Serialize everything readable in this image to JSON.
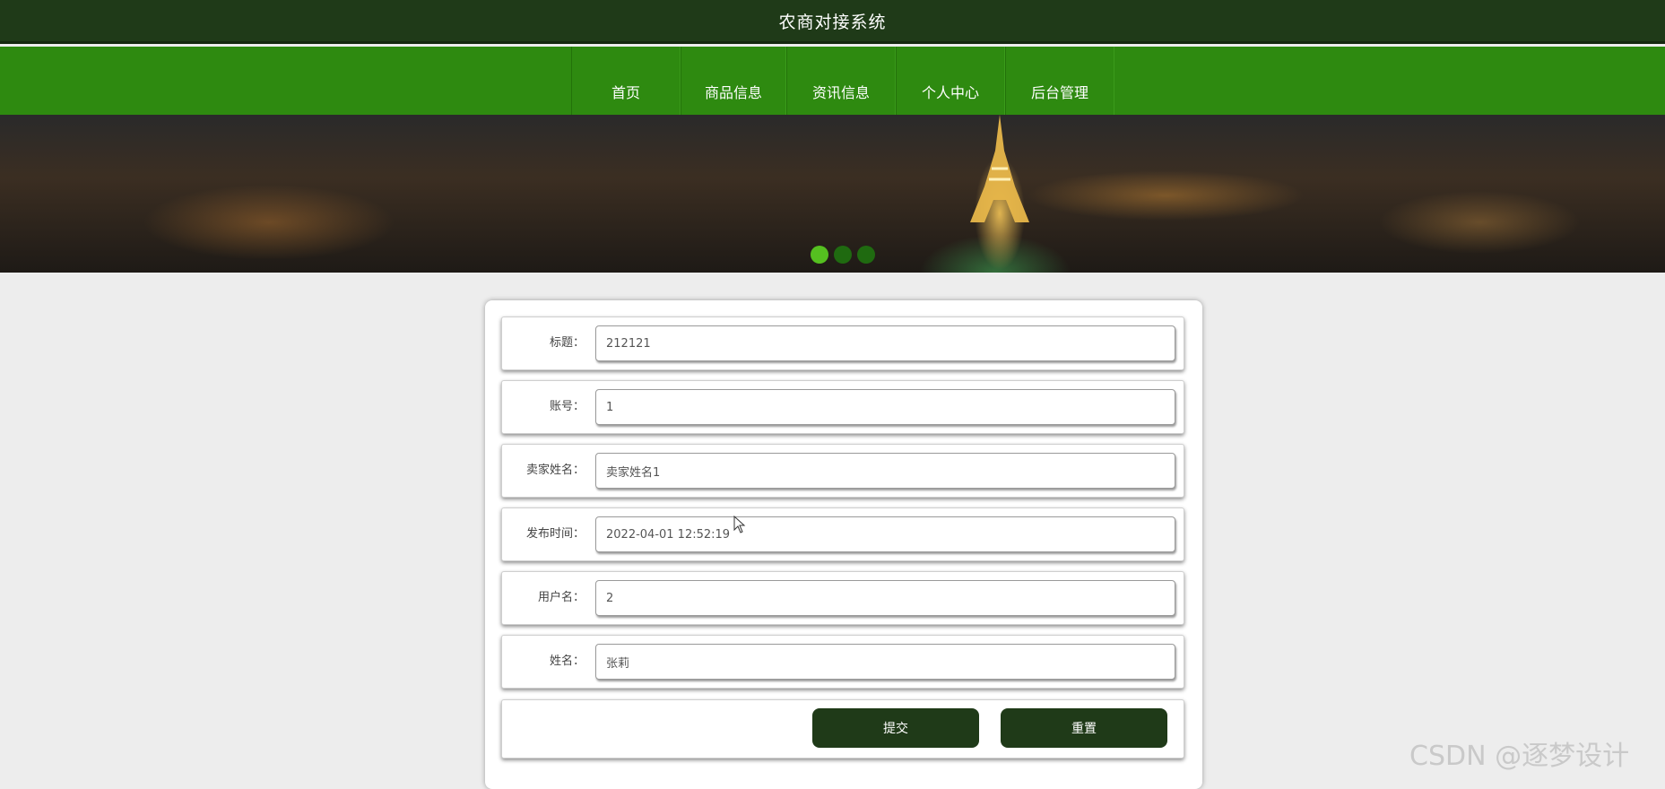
{
  "header": {
    "site_title": "农商对接系统"
  },
  "nav": {
    "items": [
      {
        "label": "首页"
      },
      {
        "label": "商品信息"
      },
      {
        "label": "资讯信息"
      },
      {
        "label": "个人中心"
      },
      {
        "label": "后台管理"
      }
    ]
  },
  "banner": {
    "slides_total": 3,
    "active_slide": 1
  },
  "form": {
    "fields": [
      {
        "label": "标题：",
        "value": "212121"
      },
      {
        "label": "账号：",
        "value": "1"
      },
      {
        "label": "卖家姓名：",
        "value": "卖家姓名1"
      },
      {
        "label": "发布时间：",
        "value": "2022-04-01 12:52:19"
      },
      {
        "label": "用户名：",
        "value": "2"
      },
      {
        "label": "姓名：",
        "value": "张莉"
      }
    ],
    "submit_label": "提交",
    "reset_label": "重置"
  },
  "watermark": "CSDN @逐梦设计"
}
